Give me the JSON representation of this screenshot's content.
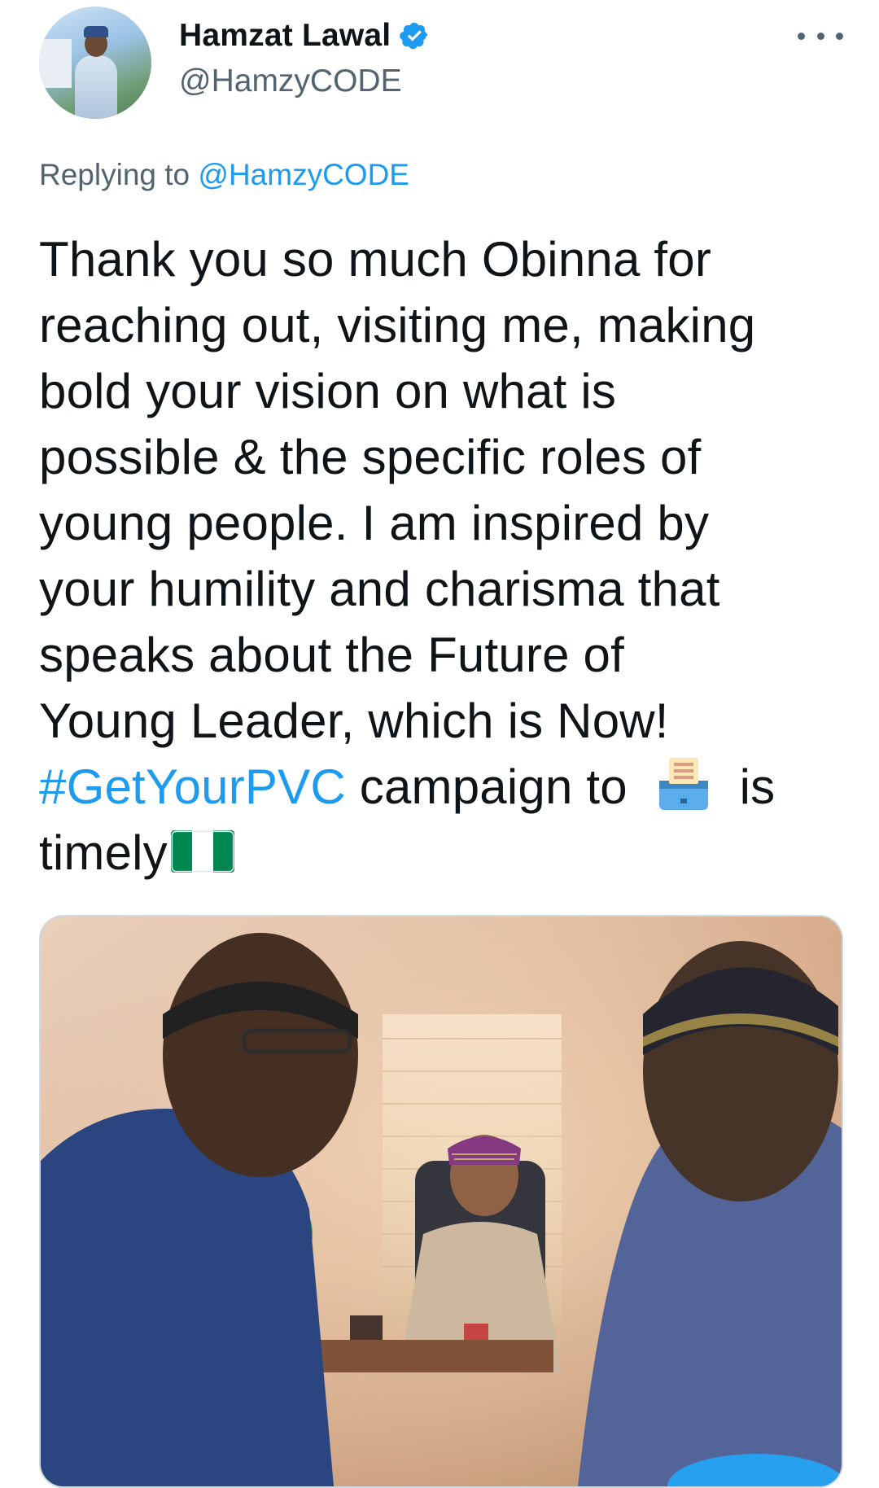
{
  "tweet": {
    "author": {
      "display_name": "Hamzat Lawal",
      "handle": "@HamzyCODE",
      "verified": true
    },
    "replying_to": {
      "prefix": "Replying to",
      "mention": "@HamzyCODE"
    },
    "text_lines": [
      "Thank you so much Obinna for",
      "reaching out, visiting me, making",
      "bold your vision on what is",
      "possible & the specific roles of",
      "young people. I am inspired by",
      "your humility and charisma that",
      "speaks about the Future of",
      "Young Leader, which is Now!"
    ],
    "hashtag": "#GetYourPVC",
    "after_hashtag": "campaign to",
    "after_emoji": "is",
    "last_word": "timely",
    "emojis": {
      "ballot": "ballot-box-emoji",
      "flag": "nigeria-flag-emoji"
    },
    "media": {
      "description_icon": "photo-icon"
    }
  },
  "colors": {
    "link": "#1d9bf0",
    "text": "#0f1419",
    "secondary": "#536471",
    "verified": "#1d9bf0",
    "flag_green": "#008751"
  }
}
